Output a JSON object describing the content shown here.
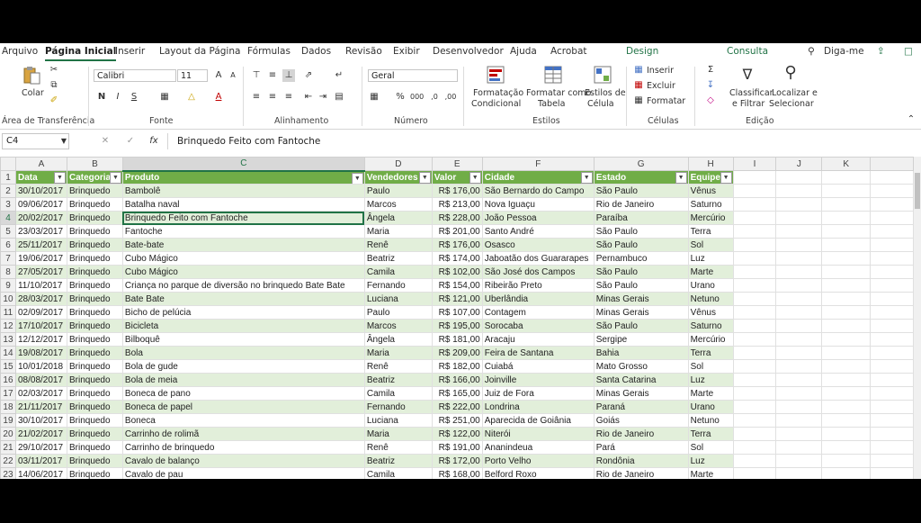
{
  "tabs": [
    {
      "label": "Arquivo"
    },
    {
      "label": "Página Inicial"
    },
    {
      "label": "Inserir"
    },
    {
      "label": "Layout da Página"
    },
    {
      "label": "Fórmulas"
    },
    {
      "label": "Dados"
    },
    {
      "label": "Revisão"
    },
    {
      "label": "Exibir"
    },
    {
      "label": "Desenvolvedor"
    },
    {
      "label": "Ajuda"
    },
    {
      "label": "Acrobat"
    },
    {
      "label": "Design"
    },
    {
      "label": "Consulta"
    }
  ],
  "tell_me": "Diga-me",
  "ribbon": {
    "paste": "Colar",
    "clipboard": "Área de Transferência",
    "font_name": "Calibri",
    "font_size": "11",
    "font_group": "Fonte",
    "bold": "N",
    "italic": "I",
    "underline": "S",
    "align_group": "Alinhamento",
    "number_format": "Geral",
    "number_group": "Número",
    "cond_format_1": "Formatação",
    "cond_format_2": "Condicional",
    "format_table_1": "Formatar como",
    "format_table_2": "Tabela",
    "cell_styles_1": "Estilos de",
    "cell_styles_2": "Célula",
    "styles_group": "Estilos",
    "insert": "Inserir",
    "delete": "Excluir",
    "format": "Formatar",
    "cells_group": "Células",
    "sort_1": "Classificar",
    "sort_2": "e Filtrar",
    "find_1": "Localizar e",
    "find_2": "Selecionar",
    "editing_group": "Edição"
  },
  "formula_bar": {
    "name_box": "C4",
    "formula": "Brinquedo Feito com Fantoche",
    "fx": "fx"
  },
  "columns": [
    "A",
    "B",
    "C",
    "D",
    "E",
    "F",
    "G",
    "H",
    "I",
    "J",
    "K"
  ],
  "headers": [
    "Data",
    "Categoria",
    "Produto",
    "Vendedores",
    "Valor",
    "Cidade",
    "Estado",
    "Equipe"
  ],
  "rows": [
    [
      "30/10/2017",
      "Brinquedo",
      "Bambolê",
      "Paulo",
      "R$ 176,00",
      "São Bernardo do Campo",
      "São Paulo",
      "Vênus"
    ],
    [
      "09/06/2017",
      "Brinquedo",
      "Batalha naval",
      "Marcos",
      "R$ 213,00",
      "Nova Iguaçu",
      "Rio de Janeiro",
      "Saturno"
    ],
    [
      "20/02/2017",
      "Brinquedo",
      "Brinquedo Feito com Fantoche",
      "Ângela",
      "R$ 228,00",
      "João Pessoa",
      "Paraíba",
      "Mercúrio"
    ],
    [
      "23/03/2017",
      "Brinquedo",
      "Fantoche",
      "Maria",
      "R$ 201,00",
      "Santo André",
      "São Paulo",
      "Terra"
    ],
    [
      "25/11/2017",
      "Brinquedo",
      "Bate-bate",
      "Renê",
      "R$ 176,00",
      "Osasco",
      "São Paulo",
      "Sol"
    ],
    [
      "19/06/2017",
      "Brinquedo",
      "Cubo Mágico",
      "Beatriz",
      "R$ 174,00",
      "Jaboatão dos Guararapes",
      "Pernambuco",
      "Luz"
    ],
    [
      "27/05/2017",
      "Brinquedo",
      "Cubo Mágico",
      "Camila",
      "R$ 102,00",
      "São José dos Campos",
      "São Paulo",
      "Marte"
    ],
    [
      "11/10/2017",
      "Brinquedo",
      "Criança no parque de diversão  no brinquedo Bate Bate",
      "Fernando",
      "R$ 154,00",
      "Ribeirão Preto",
      "São Paulo",
      "Urano"
    ],
    [
      "28/03/2017",
      "Brinquedo",
      "Bate Bate",
      "Luciana",
      "R$ 121,00",
      "Uberlândia",
      "Minas Gerais",
      "Netuno"
    ],
    [
      "02/09/2017",
      "Brinquedo",
      "Bicho de pelúcia",
      "Paulo",
      "R$ 107,00",
      "Contagem",
      "Minas Gerais",
      "Vênus"
    ],
    [
      "17/10/2017",
      "Brinquedo",
      "Bicicleta",
      "Marcos",
      "R$ 195,00",
      "Sorocaba",
      "São Paulo",
      "Saturno"
    ],
    [
      "12/12/2017",
      "Brinquedo",
      "Bilboquê",
      "Ângela",
      "R$ 181,00",
      "Aracaju",
      "Sergipe",
      "Mercúrio"
    ],
    [
      "19/08/2017",
      "Brinquedo",
      "Bola",
      "Maria",
      "R$ 209,00",
      "Feira de Santana",
      "Bahia",
      "Terra"
    ],
    [
      "10/01/2018",
      "Brinquedo",
      "Bola de gude",
      "Renê",
      "R$ 182,00",
      "Cuiabá",
      "Mato Grosso",
      "Sol"
    ],
    [
      "08/08/2017",
      "Brinquedo",
      "Bola de meia",
      "Beatriz",
      "R$ 166,00",
      "Joinville",
      "Santa Catarina",
      "Luz"
    ],
    [
      "02/03/2017",
      "Brinquedo",
      "Boneca de pano",
      "Camila",
      "R$ 165,00",
      "Juiz de Fora",
      "Minas Gerais",
      "Marte"
    ],
    [
      "21/11/2017",
      "Brinquedo",
      "Boneca de papel",
      "Fernando",
      "R$ 222,00",
      "Londrina",
      "Paraná",
      "Urano"
    ],
    [
      "30/10/2017",
      "Brinquedo",
      "Boneca",
      "Luciana",
      "R$ 251,00",
      "Aparecida de Goiânia",
      "Goiás",
      "Netuno"
    ],
    [
      "21/02/2017",
      "Brinquedo",
      "Carrinho de rolimã",
      "Maria",
      "R$ 122,00",
      "Niterói",
      "Rio de Janeiro",
      "Terra"
    ],
    [
      "29/10/2017",
      "Brinquedo",
      "Carrinho de brinquedo",
      "Renê",
      "R$ 191,00",
      "Ananindeua",
      "Pará",
      "Sol"
    ],
    [
      "03/11/2017",
      "Brinquedo",
      "Cavalo de balanço",
      "Beatriz",
      "R$ 172,00",
      "Porto Velho",
      "Rondônia",
      "Luz"
    ],
    [
      "14/06/2017",
      "Brinquedo",
      "Cavalo de pau",
      "Camila",
      "R$ 168,00",
      "Belford Roxo",
      "Rio de Janeiro",
      "Marte"
    ]
  ]
}
